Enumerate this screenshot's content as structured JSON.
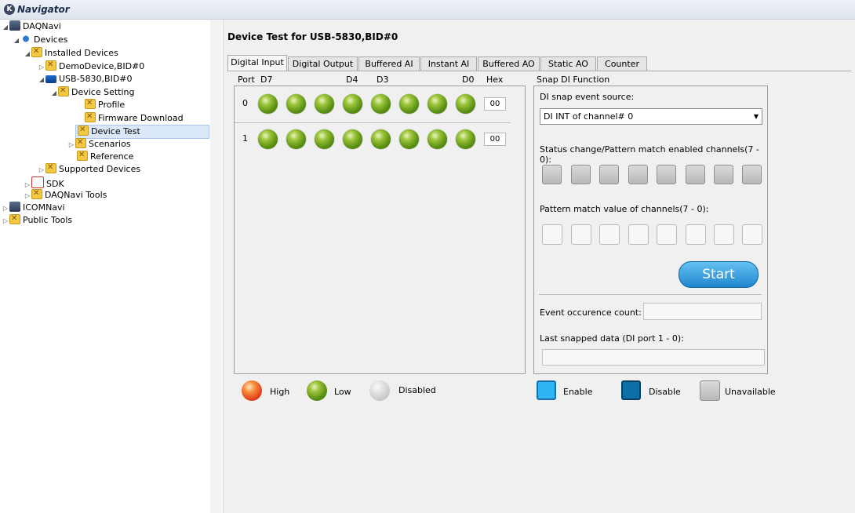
{
  "window": {
    "title": "Navigator",
    "logo_glyph": "K"
  },
  "tree": [
    {
      "label": "DAQNavi",
      "icon": "computer-icon",
      "arrow": "◢"
    },
    {
      "label": "Devices",
      "icon": "devices-icon",
      "arrow": "◢"
    },
    {
      "label": "Installed Devices",
      "icon": "tool-icon",
      "arrow": "◢"
    },
    {
      "label": "DemoDevice,BID#0",
      "icon": "tool-icon",
      "arrow": "▷"
    },
    {
      "label": "USB-5830,BID#0",
      "icon": "board-icon",
      "arrow": "◢"
    },
    {
      "label": "Device Setting",
      "icon": "tool-icon",
      "arrow": "◢"
    },
    {
      "label": "Profile",
      "icon": "tool-icon",
      "arrow": ""
    },
    {
      "label": "Firmware Download",
      "icon": "tool-icon",
      "arrow": ""
    },
    {
      "label": "Device Test",
      "icon": "tool-icon",
      "arrow": "",
      "selected": true
    },
    {
      "label": "Scenarios",
      "icon": "tool-icon",
      "arrow": "▷"
    },
    {
      "label": "Reference",
      "icon": "tool-icon",
      "arrow": ""
    },
    {
      "label": "Supported Devices",
      "icon": "tool-icon",
      "arrow": "▷"
    },
    {
      "label": "SDK",
      "icon": "sdk-icon",
      "arrow": "▷"
    },
    {
      "label": "DAQNavi Tools",
      "icon": "tool-icon",
      "arrow": "▷"
    },
    {
      "label": "ICOMNavi",
      "icon": "computer-icon",
      "arrow": "▷"
    },
    {
      "label": "Public Tools",
      "icon": "tool-icon",
      "arrow": "▷"
    }
  ],
  "main": {
    "heading": "Device Test for USB-5830,BID#0",
    "tabs": [
      "Digital Input",
      "Digital Output",
      "Buffered AI",
      "Instant AI",
      "Buffered AO",
      "Static AO",
      "Counter"
    ],
    "active_tab": "Digital Input"
  },
  "digital_input": {
    "header": {
      "port": "Port",
      "d7": "D7",
      "d4": "D4",
      "d3": "D3",
      "d0": "D0",
      "hex": "Hex"
    },
    "ports": [
      {
        "id": "0",
        "hex": "00",
        "bits": [
          "low",
          "low",
          "low",
          "low",
          "low",
          "low",
          "low",
          "low"
        ]
      },
      {
        "id": "1",
        "hex": "00",
        "bits": [
          "low",
          "low",
          "low",
          "low",
          "low",
          "low",
          "low",
          "low"
        ]
      }
    ]
  },
  "snap": {
    "title": "Snap DI Function",
    "source_label": "DI snap event source:",
    "source_value": "DI INT of channel# 0",
    "enabled_label": "Status change/Pattern match enabled channels(7 - 0):",
    "pattern_label": "Pattern match value of channels(7 - 0):",
    "start": "Start",
    "count_label": "Event occurence count:",
    "count_value": "",
    "last_label": "Last snapped data (DI port 1 - 0):",
    "last_value": ""
  },
  "legend": {
    "high": "High",
    "low": "Low",
    "disabled": "Disabled",
    "enable": "Enable",
    "disable": "Disable",
    "unavailable": "Unavailable"
  },
  "colors": {
    "led_low": "#5d9214",
    "led_high": "#e23c1c",
    "enable": "#2fb6f2",
    "disable": "#0d6fa8",
    "start_button": "#1f86cc"
  }
}
